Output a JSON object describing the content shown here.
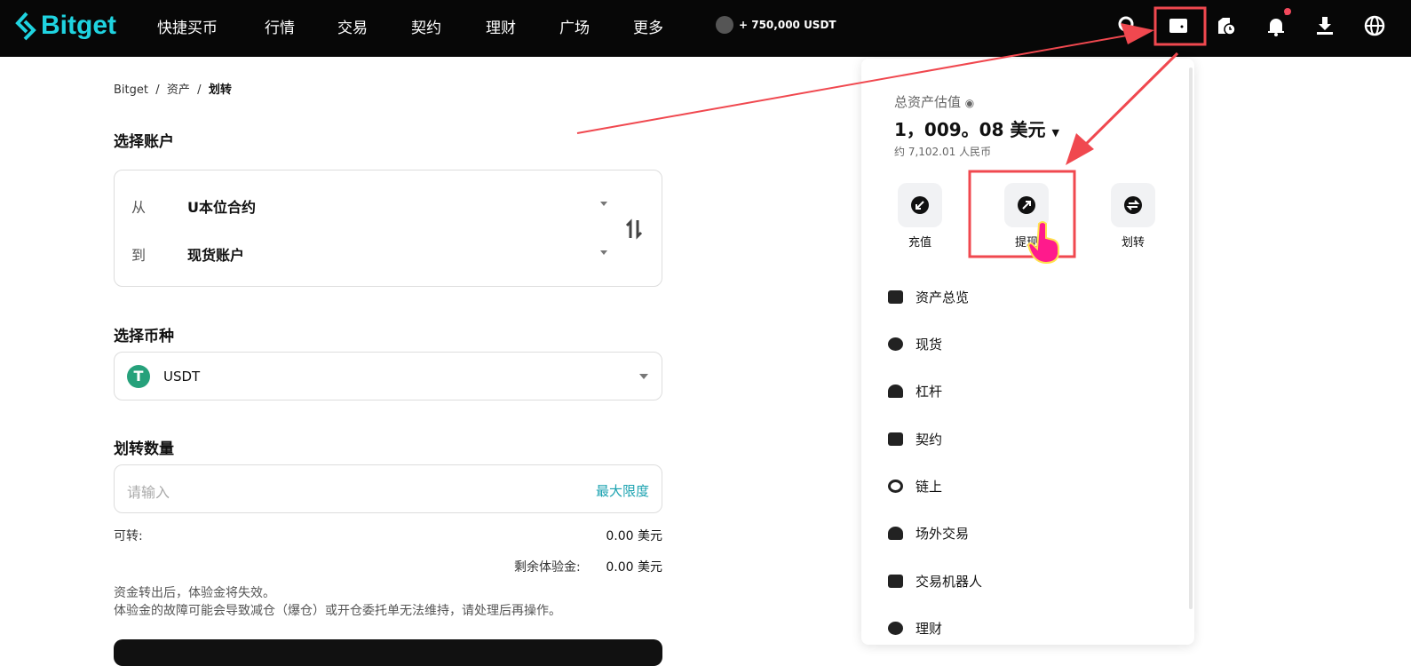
{
  "nav": {
    "logo": "Bitget",
    "items": [
      "快捷买币",
      "行情",
      "交易",
      "契约",
      "理财",
      "广场",
      "更多"
    ],
    "promo": "+ 750,000 USDT",
    "icons": [
      "search-icon",
      "wallet-icon",
      "order-history-icon",
      "bell-icon",
      "download-icon",
      "globe-icon"
    ],
    "accent": "#1fd3e0"
  },
  "breadcrumb": [
    "Bitget",
    "资产",
    "划转"
  ],
  "account": {
    "title": "选择账户",
    "from_label": "从",
    "from_value": "U本位合约",
    "to_label": "到",
    "to_value": "现货账户"
  },
  "coin": {
    "title": "选择币种",
    "value": "USDT",
    "color": "#26a17b"
  },
  "amount": {
    "title": "划转数量",
    "placeholder": "请输入",
    "max": "最大限度",
    "available_label": "可转:",
    "available_value": "0.00 美元",
    "trial_label": "剩余体验金:",
    "trial_value": "0.00 美元",
    "note1": "资金转出后，体验金将失效。",
    "note2": "体验金的故障可能会导致减仓（爆仓）或开仓委托单无法维持，请处理后再操作。"
  },
  "panel": {
    "title": "总资产估值",
    "total": "1，009。08 美元",
    "cny": "约 7,102.01 人民币",
    "actions": [
      "充值",
      "提现",
      "划转"
    ],
    "menu": [
      "资产总览",
      "现货",
      "杠杆",
      "契约",
      "链上",
      "场外交易",
      "交易机器人",
      "理财"
    ]
  },
  "annotation_color": "#f0484f"
}
